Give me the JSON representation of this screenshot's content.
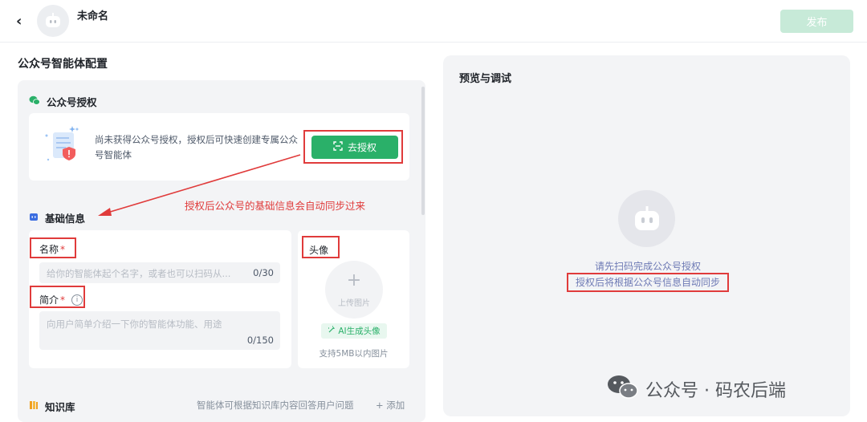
{
  "header": {
    "back_label": "‹",
    "app_name": "未命名",
    "publish_label": "发布"
  },
  "config": {
    "title": "公众号智能体配置"
  },
  "auth": {
    "section_title": "公众号授权",
    "description": "尚未获得公众号授权，授权后可快速创建专属公众号智能体",
    "button_label": "去授权"
  },
  "annotation": {
    "text": "授权后公众号的基础信息会自动同步过来"
  },
  "basic": {
    "section_title": "基础信息",
    "name_label": "名称",
    "required_mark": "*",
    "name_placeholder": "给你的智能体起个名字，或者也可以扫码从...",
    "name_counter": "0/30",
    "intro_label": "简介",
    "intro_info": "i",
    "intro_placeholder": "向用户简单介绍一下你的智能体功能、用途",
    "intro_counter": "0/150",
    "avatar_label": "头像",
    "upload_plus": "+",
    "upload_label": "上传图片",
    "ai_badge": "AI生成头像",
    "upload_hint": "支持5MB以内图片"
  },
  "knowledge": {
    "section_title": "知识库",
    "description": "智能体可根据知识库内容回答用户问题",
    "add_label": "+ 添加"
  },
  "preview": {
    "title": "预览与调试",
    "hint_line1": "请先扫码完成公众号授权",
    "hint_line2": "授权后将根据公众号信息自动同步"
  },
  "watermark": {
    "text": "公众号 · 码农后端"
  },
  "colors": {
    "accent_green": "#2ab069",
    "annotation_red": "#e03b3b",
    "panel_bg": "#f3f4f6"
  },
  "icons": [
    "back-arrow-icon",
    "robot-avatar-icon",
    "wechat-icon",
    "document-shield-illustration",
    "qr-scan-icon",
    "basic-info-icon",
    "info-icon",
    "magic-icon",
    "knowledge-icon",
    "wechat-watermark-icon"
  ]
}
